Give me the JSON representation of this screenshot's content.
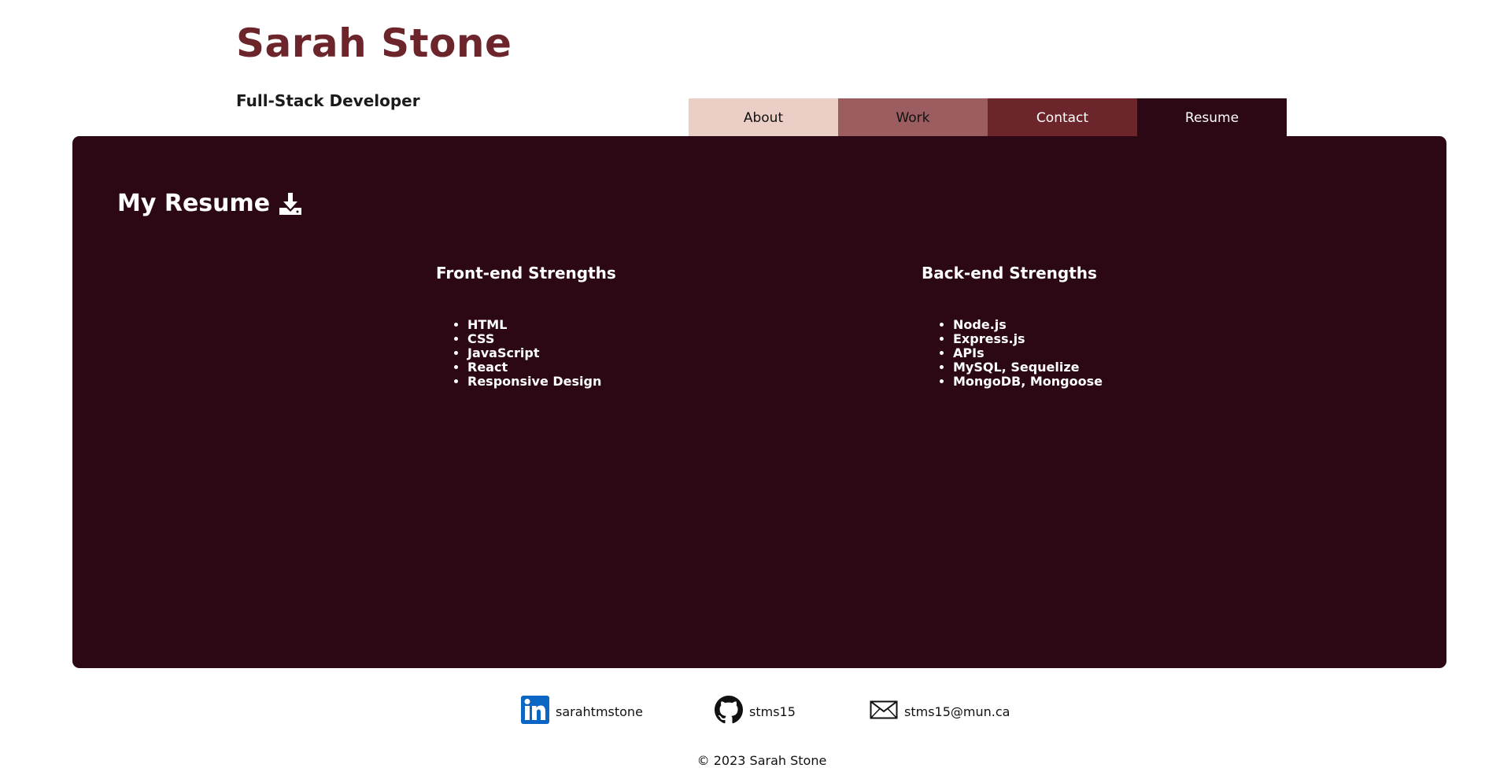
{
  "header": {
    "name": "Sarah Stone",
    "tagline": "Full-Stack Developer"
  },
  "nav": {
    "tabs": [
      {
        "label": "About"
      },
      {
        "label": "Work"
      },
      {
        "label": "Contact"
      },
      {
        "label": "Resume"
      }
    ],
    "active": "Resume"
  },
  "main": {
    "heading": "My Resume",
    "heading_icon": "download-icon",
    "front_end": {
      "title": "Front-end Strengths",
      "items": [
        "HTML",
        "CSS",
        "JavaScript",
        "React",
        "Responsive Design"
      ]
    },
    "back_end": {
      "title": "Back-end Strengths",
      "items": [
        "Node.js",
        "Express.js",
        "APIs",
        "MySQL, Sequelize",
        "MongoDB, Mongoose"
      ]
    }
  },
  "footer": {
    "links": [
      {
        "icon": "linkedin-icon",
        "label": "sarahtmstone"
      },
      {
        "icon": "github-icon",
        "label": "stms15"
      },
      {
        "icon": "mail-icon",
        "label": "stms15@mun.ca"
      }
    ],
    "copyright": "© 2023 Sarah Stone"
  },
  "colors": {
    "brand": "#6b252b",
    "panel": "#2c0815",
    "tab_about": "#ebcfc6",
    "tab_work": "#9b5d60",
    "linkedin": "#0a66c2"
  }
}
